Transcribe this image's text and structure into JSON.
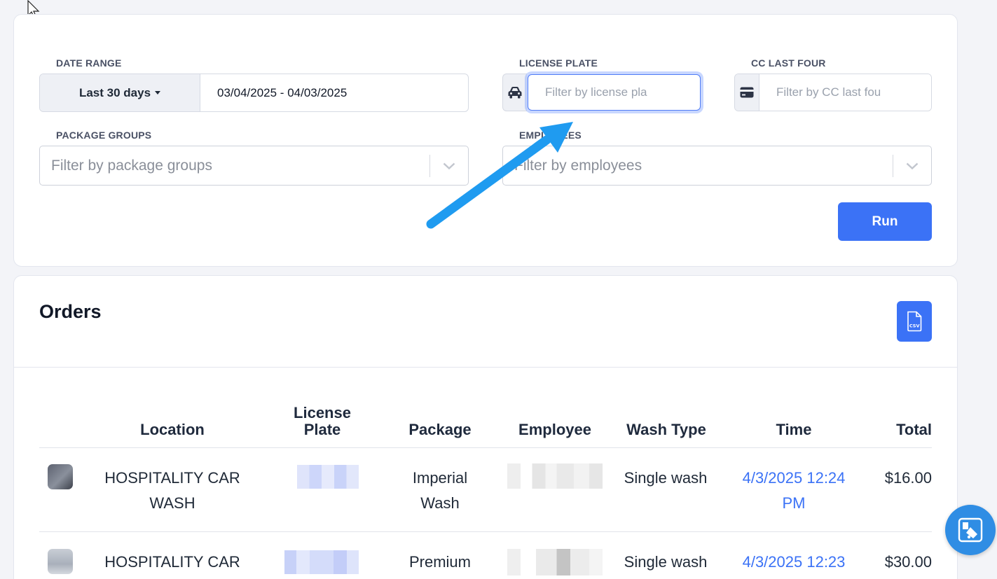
{
  "filters": {
    "date_range": {
      "label": "DATE RANGE",
      "preset": "Last 30 days",
      "value": "03/04/2025 - 04/03/2025"
    },
    "license_plate": {
      "label": "LICENSE PLATE",
      "placeholder": "Filter by license pla",
      "icon": "car-icon"
    },
    "cc_last_four": {
      "label": "CC LAST FOUR",
      "placeholder": "Filter by CC last fou",
      "icon": "credit-card-icon"
    },
    "package_groups": {
      "label": "PACKAGE GROUPS",
      "placeholder": "Filter by package groups"
    },
    "employees": {
      "label": "EMPLOYEES",
      "placeholder": "Filter by employees"
    },
    "run_label": "Run"
  },
  "orders": {
    "title": "Orders",
    "csv_label": "CSV",
    "columns": [
      "Location",
      "License Plate",
      "Package",
      "Employee",
      "Wash Type",
      "Time",
      "Total"
    ],
    "rows": [
      {
        "location": "HOSPITALITY CAR WASH",
        "package": "Imperial Wash",
        "wash_type": "Single wash",
        "time": "4/3/2025 12:24 PM",
        "total": "$16.00"
      },
      {
        "location": "HOSPITALITY CAR WASH",
        "package": "Premium",
        "wash_type": "Single wash",
        "time": "4/3/2025 12:23",
        "total": "$30.00"
      }
    ]
  },
  "colors": {
    "primary": "#3b72f6",
    "annotation_arrow": "#1f9bf0",
    "link": "#3b72f6"
  }
}
